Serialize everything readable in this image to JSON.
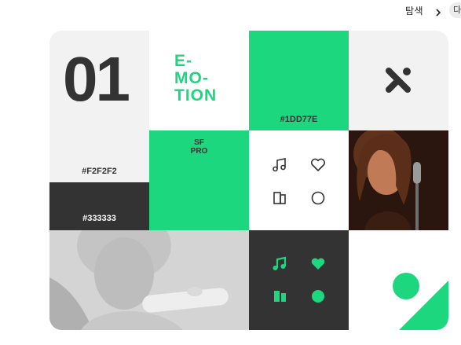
{
  "topbar": {
    "explore_label": "탐색",
    "edge_button_label": "다"
  },
  "card": {
    "number": "01",
    "title_lines": [
      "E-",
      "MO-",
      "TION"
    ],
    "font_lines": [
      "SF",
      "PRO"
    ],
    "swatches": {
      "light": "#F2F2F2",
      "dark": "#333333",
      "green": "#1DD77E"
    }
  },
  "colors": {
    "green": "#1dd77e",
    "dark": "#333333",
    "light": "#f2f2f2"
  },
  "icons": {
    "outline": [
      "music-note-icon",
      "heart-icon",
      "pages-icon",
      "circle-icon"
    ],
    "filled": [
      "music-note-icon",
      "heart-icon",
      "pages-icon",
      "circle-icon"
    ]
  }
}
